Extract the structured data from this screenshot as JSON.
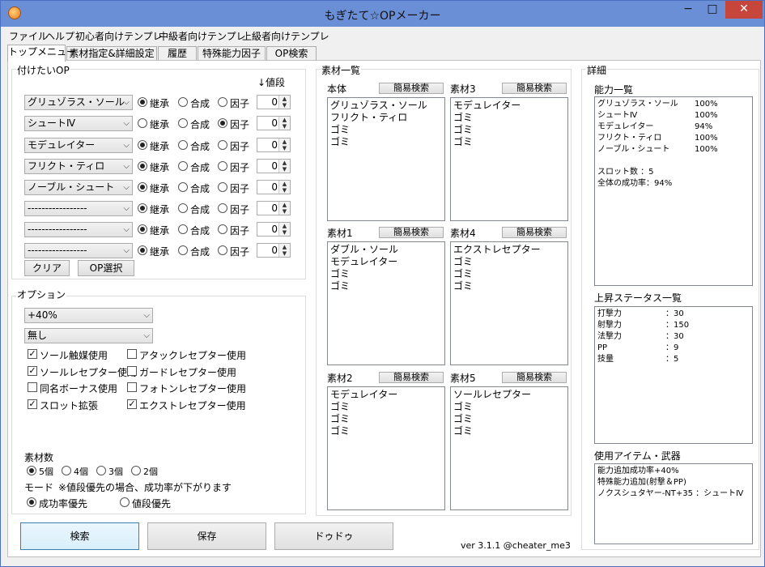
{
  "window": {
    "title": "もぎたて☆OPメーカー",
    "minimize": "−",
    "maximize": "□",
    "close": "✕"
  },
  "menu": [
    "ファイル",
    "ヘルプ",
    "初心者向けテンプレ",
    "中級者向けテンプレ",
    "上級者向けテンプレ"
  ],
  "tabs": [
    "トップメニュー",
    "素材指定&詳細設定",
    "履歴",
    "特殊能力因子",
    "OP検索"
  ],
  "op": {
    "group_label": "付けたいOP",
    "value_header": "↓値段",
    "radio_labels": [
      "継承",
      "合成",
      "因子"
    ],
    "rows": [
      {
        "name": "グリュゾラス・ソール",
        "mode": "継承",
        "value": "0"
      },
      {
        "name": "シュートⅣ",
        "mode": "因子",
        "value": "0"
      },
      {
        "name": "モデュレイター",
        "mode": "継承",
        "value": "0"
      },
      {
        "name": "フリクト・ティロ",
        "mode": "継承",
        "value": "0"
      },
      {
        "name": "ノーブル・シュート",
        "mode": "継承",
        "value": "0"
      },
      {
        "name": "-----------------",
        "mode": "継承",
        "value": "0"
      },
      {
        "name": "-----------------",
        "mode": "継承",
        "value": "0"
      },
      {
        "name": "-----------------",
        "mode": "継承",
        "value": "0"
      }
    ],
    "clear_label": "クリア",
    "select_label": "OP選択"
  },
  "options": {
    "group_label": "オプション",
    "boost": "+40%",
    "item": "無し",
    "checks": [
      {
        "label": "ソール触媒使用",
        "checked": true
      },
      {
        "label": "アタックレセプター使用",
        "checked": false
      },
      {
        "label": "ソールレセプター使用",
        "checked": true
      },
      {
        "label": "ガードレセプター使用",
        "checked": false
      },
      {
        "label": "同名ボーナス使用",
        "checked": false
      },
      {
        "label": "フォトンレセプター使用",
        "checked": false
      },
      {
        "label": "スロット拡張",
        "checked": true
      },
      {
        "label": "エクストレセプター使用",
        "checked": true
      }
    ],
    "count_label": "素材数",
    "counts": [
      "5個",
      "4個",
      "3個",
      "2個"
    ],
    "count_selected": "5個",
    "mode_label": "モード",
    "mode_note": "※値段優先の場合、成功率が下がります",
    "modes": [
      "成功率優先",
      "値段優先"
    ],
    "mode_selected": "成功率優先"
  },
  "materials": {
    "group_label": "素材一覧",
    "search_label": "簡易検索",
    "boxes": [
      {
        "title": "本体",
        "items": [
          "グリュゾラス・ソール",
          "フリクト・ティロ",
          "ゴミ",
          "ゴミ"
        ]
      },
      {
        "title": "素材3",
        "items": [
          "モデュレイター",
          "ゴミ",
          "ゴミ",
          "ゴミ"
        ]
      },
      {
        "title": "素材1",
        "items": [
          "ダブル・ソール",
          "モデュレイター",
          "ゴミ",
          "ゴミ"
        ]
      },
      {
        "title": "素材4",
        "items": [
          "エクストレセプター",
          "ゴミ",
          "ゴミ",
          "ゴミ"
        ]
      },
      {
        "title": "素材2",
        "items": [
          "モデュレイター",
          "ゴミ",
          "ゴミ",
          "ゴミ"
        ]
      },
      {
        "title": "素材5",
        "items": [
          "ソールレセプター",
          "ゴミ",
          "ゴミ",
          "ゴミ"
        ]
      }
    ]
  },
  "details": {
    "group_label": "詳細",
    "ability_title": "能力一覧",
    "abilities": [
      {
        "name": "グリュゾラス・ソール",
        "rate": "100%"
      },
      {
        "name": "シュートⅣ",
        "rate": "100%"
      },
      {
        "name": "モデュレイター",
        "rate": "94%"
      },
      {
        "name": "フリクト・ティロ",
        "rate": "100%"
      },
      {
        "name": "ノーブル・シュート",
        "rate": "100%"
      }
    ],
    "slot_line": "スロット数 ：5",
    "total_line": "全体の成功率：94%",
    "status_title": "上昇ステータス一覧",
    "stats": [
      {
        "name": "打撃力",
        "value": "：30"
      },
      {
        "name": "射撃力",
        "value": "：150"
      },
      {
        "name": "法撃力",
        "value": "：30"
      },
      {
        "name": "PP",
        "value": "：9"
      },
      {
        "name": "技量",
        "value": "：5"
      }
    ],
    "items_title": "使用アイテム・武器",
    "items": [
      "能力追加成功率+40%",
      "特殊能力追加(射撃＆PP)",
      "ノクスシュタヤー-NT+35 ：シュートⅣ"
    ]
  },
  "footer": {
    "search": "検索",
    "save": "保存",
    "dodo": "ドゥドゥ",
    "version": "ver 3.1.1 @cheater_me3"
  }
}
